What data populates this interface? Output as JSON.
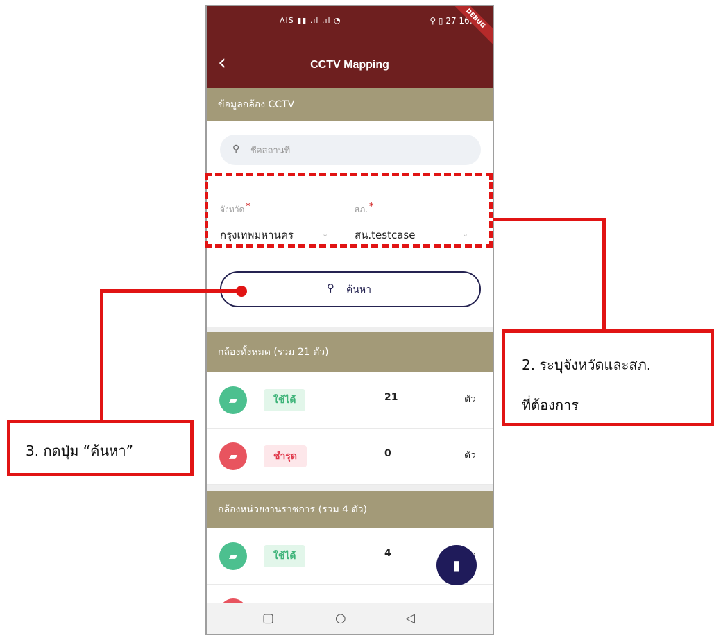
{
  "status_bar": {
    "left_icons": "AIS ▮▮ .ıl .ıl ◔",
    "right": "⚲ ▯ 27 16:46",
    "debug_label": "DEBUG"
  },
  "app_bar": {
    "title": "CCTV Mapping"
  },
  "camera_info": {
    "header": "ข้อมูลกล้อง CCTV",
    "search_placeholder": "ชื่อสถานที่",
    "province": {
      "label": "จังหวัด",
      "required": "*",
      "value": "กรุงเทพมหานคร"
    },
    "station": {
      "label": "สภ.",
      "required": "*",
      "value": "สน.testcase"
    },
    "search_button": "ค้นหา"
  },
  "all_cameras": {
    "header": "กล้องทั้งหมด (รวม 21 ตัว)",
    "rows": [
      {
        "status": "ใช้ได้",
        "count": "21",
        "unit": "ตัว"
      },
      {
        "status": "ชำรุด",
        "count": "0",
        "unit": "ตัว"
      }
    ]
  },
  "gov_cameras": {
    "header": "กล้องหน่วยงานราชการ (รวม 4 ตัว)",
    "rows": [
      {
        "status": "ใช้ได้",
        "count": "4",
        "unit": "ตัว"
      }
    ]
  },
  "annotations": {
    "step2_line1": "2. ระบุจังหวัดและสภ.",
    "step2_line2": "ที่ต้องการ",
    "step3": "3. กดปุ่ม “ค้นหา”"
  },
  "colors": {
    "appbar": "#6e1f1f",
    "section": "#a39a78",
    "ok_green": "#4cc08f",
    "broken_red": "#e8545f",
    "fab": "#1f1b5a",
    "annotation_red": "#e11414"
  }
}
